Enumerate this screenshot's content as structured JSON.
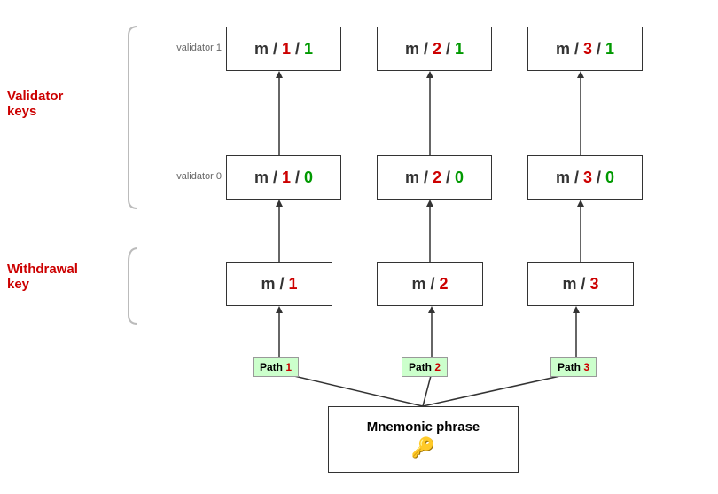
{
  "labels": {
    "validator_keys": "Validator keys",
    "withdrawal_key": "Withdrawal key",
    "validator_1": "validator 1",
    "validator_0": "validator 0",
    "mnemonic": "Mnemonic phrase"
  },
  "paths": {
    "path1": "Path 1",
    "path2": "Path 2",
    "path3": "Path 3"
  },
  "boxes": {
    "v1_1": {
      "m": "m / ",
      "num": "1",
      "slash": " / ",
      "idx": "1"
    },
    "v1_2": {
      "m": "m / ",
      "num": "2",
      "slash": " / ",
      "idx": "1"
    },
    "v1_3": {
      "m": "m / ",
      "num": "3",
      "slash": " / ",
      "idx": "1"
    },
    "v0_1": {
      "m": "m / ",
      "num": "1",
      "slash": " / ",
      "idx": "0"
    },
    "v0_2": {
      "m": "m / ",
      "num": "2",
      "slash": " / ",
      "idx": "0"
    },
    "v0_3": {
      "m": "m / ",
      "num": "3",
      "slash": " / ",
      "idx": "0"
    },
    "w1": {
      "m": "m / ",
      "num": "1"
    },
    "w2": {
      "m": "m / ",
      "num": "2"
    },
    "w3": {
      "m": "m / ",
      "num": "3"
    }
  }
}
